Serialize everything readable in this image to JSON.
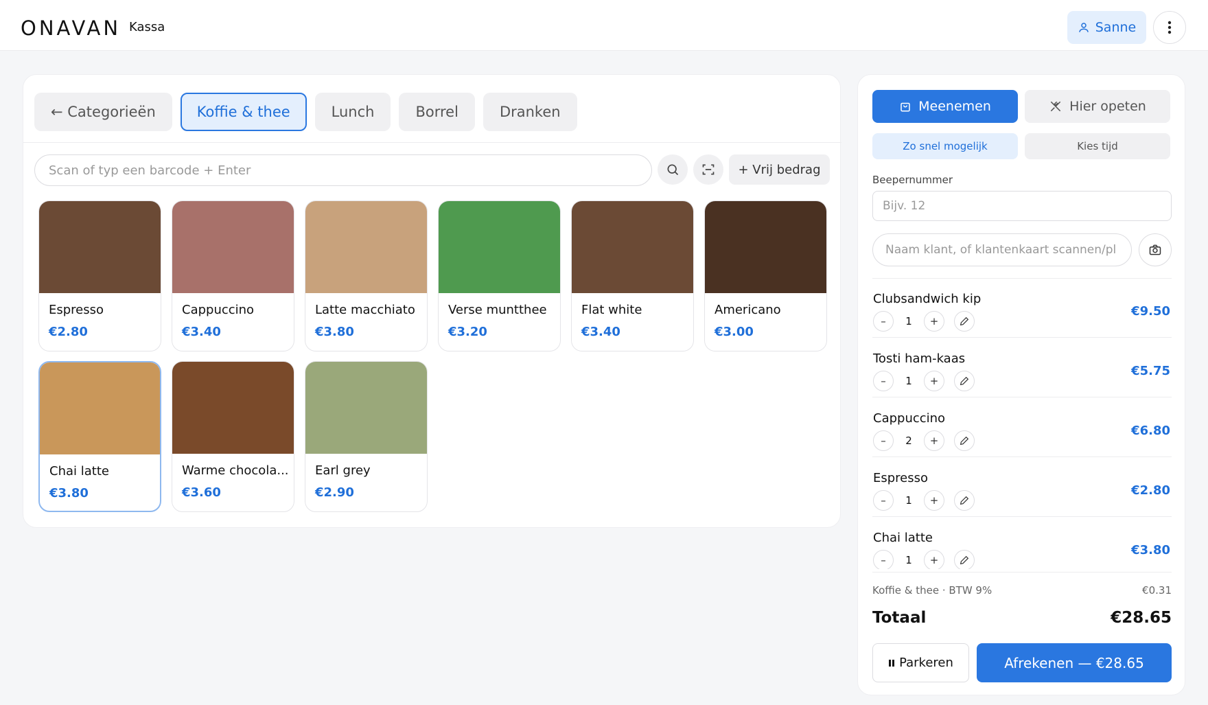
{
  "header": {
    "brand": "ONAVAN",
    "app_name": "Kassa",
    "user_name": "Sanne"
  },
  "tabs": [
    {
      "label": "← Categorieën",
      "active": false
    },
    {
      "label": "Koffie & thee",
      "active": true
    },
    {
      "label": "Lunch",
      "active": false
    },
    {
      "label": "Borrel",
      "active": false
    },
    {
      "label": "Dranken",
      "active": false
    }
  ],
  "search": {
    "placeholder": "Scan of typ een barcode + Enter"
  },
  "vrij_bedrag_label": "+ Vrij bedrag",
  "products": [
    {
      "name": "Espresso",
      "price": "€2.80",
      "color": "#6b4a35"
    },
    {
      "name": "Cappuccino",
      "price": "€3.40",
      "color": "#a8716a"
    },
    {
      "name": "Latte macchiato",
      "price": "€3.80",
      "color": "#c8a27c"
    },
    {
      "name": "Verse muntthee",
      "price": "€3.20",
      "color": "#4f9a4f"
    },
    {
      "name": "Flat white",
      "price": "€3.40",
      "color": "#6b4a35"
    },
    {
      "name": "Americano",
      "price": "€3.00",
      "color": "#4a3122"
    },
    {
      "name": "Chai latte",
      "price": "€3.80",
      "color": "#c9975a"
    },
    {
      "name": "Warme chocola...",
      "price": "€3.60",
      "color": "#7a4a2a"
    },
    {
      "name": "Earl grey",
      "price": "€2.90",
      "color": "#9aa87a"
    }
  ],
  "order_panel": {
    "meenemen_label": "Meenemen",
    "hier_opeten_label": "Hier opeten",
    "zo_snel_label": "Zo snel mogelijk",
    "kies_tijd_label": "Kies tijd",
    "beeper_label": "Beepernummer",
    "beeper_placeholder": "Bijv. 12",
    "klant_placeholder": "Naam klant, of klantenkaart scannen/pl"
  },
  "order_items": [
    {
      "name": "Clubsandwich kip",
      "qty": "1",
      "price": "€9.50"
    },
    {
      "name": "Tosti ham-kaas",
      "qty": "1",
      "price": "€5.75"
    },
    {
      "name": "Cappuccino",
      "qty": "2",
      "price": "€6.80"
    },
    {
      "name": "Espresso",
      "qty": "1",
      "price": "€2.80"
    },
    {
      "name": "Chai latte",
      "qty": "1",
      "price": "€3.80"
    }
  ],
  "totals": {
    "btw_label": "Koffie & thee · BTW 9%",
    "btw_value": "€0.31",
    "total_label": "Totaal",
    "total_value": "€28.65"
  },
  "actions": {
    "park_label": "Parkeren",
    "pay_label": "Afrekenen — €28.65"
  },
  "colors": {
    "accent": "#2a77e0",
    "accent_light": "#e4effd"
  }
}
